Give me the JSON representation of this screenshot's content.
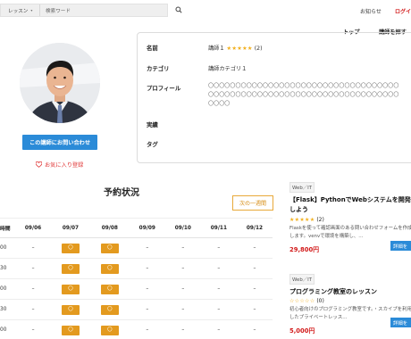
{
  "header": {
    "lesson_select": "レッスン",
    "search_placeholder": "検索ワード",
    "notice": "お知らせ",
    "login": "ログイン",
    "nav_top": "トップ",
    "nav_find": "講師を探す"
  },
  "profile": {
    "contact_button": "この講師にお問い合わせ",
    "favorite": "お気に入り登録"
  },
  "info": {
    "name_label": "名前",
    "name_value": "講師１",
    "name_stars": "★★★★★",
    "name_count": "(2)",
    "category_label": "カテゴリ",
    "category_value": "講師カテゴリ１",
    "profile_label": "プロフィール",
    "profile_text": "〇〇〇〇〇〇〇〇〇〇〇〇〇〇〇〇〇〇〇〇〇〇〇〇〇〇〇〇〇〇〇〇〇〇〇〇〇〇〇〇〇〇〇〇〇〇〇〇〇〇〇〇〇〇〇〇〇〇〇〇〇〇〇〇〇〇〇〇〇〇〇〇〇〇",
    "achievements_label": "実績",
    "tags_label": "タグ"
  },
  "reservation": {
    "title": "予約状況",
    "next_week": "次の一週間",
    "time_header": "時間",
    "dates": [
      "09/06",
      "09/07",
      "09/08",
      "09/09",
      "09/10",
      "09/11",
      "09/12"
    ],
    "rows": [
      {
        "time": "00",
        "slots": [
          "–",
          "〇",
          "〇",
          "–",
          "–",
          "–",
          "–"
        ]
      },
      {
        "time": "30",
        "slots": [
          "–",
          "〇",
          "〇",
          "–",
          "–",
          "–",
          "–"
        ]
      },
      {
        "time": "00",
        "slots": [
          "–",
          "〇",
          "〇",
          "–",
          "–",
          "–",
          "–"
        ]
      },
      {
        "time": "30",
        "slots": [
          "–",
          "〇",
          "〇",
          "–",
          "–",
          "–",
          "–"
        ]
      },
      {
        "time": "00",
        "slots": [
          "–",
          "〇",
          "〇",
          "–",
          "–",
          "–",
          "–"
        ]
      }
    ]
  },
  "lessons": [
    {
      "tag": "Web／IT",
      "title": "【Flask】PythonでWebシステムを開発しよう",
      "stars": "★★★★★",
      "count": "(2)",
      "desc": "Flaskを使って確認画面のある問い合わせフォームを作成します。venvで環境を構築し、...",
      "price": "29,800円",
      "button": "詳細を"
    },
    {
      "tag": "Web／IT",
      "title": "プログラミング教室のレッスン",
      "stars": "☆☆☆☆☆",
      "count": "(0)",
      "desc": "初心者向けのプログラミング教室です。・スカイプを利用したプライベートレッス...",
      "price": "5,000円",
      "button": "詳細を"
    }
  ],
  "colors": {
    "accent_blue": "#2b8bd8",
    "accent_orange": "#e39a1f",
    "price_red": "#d21a1a"
  }
}
